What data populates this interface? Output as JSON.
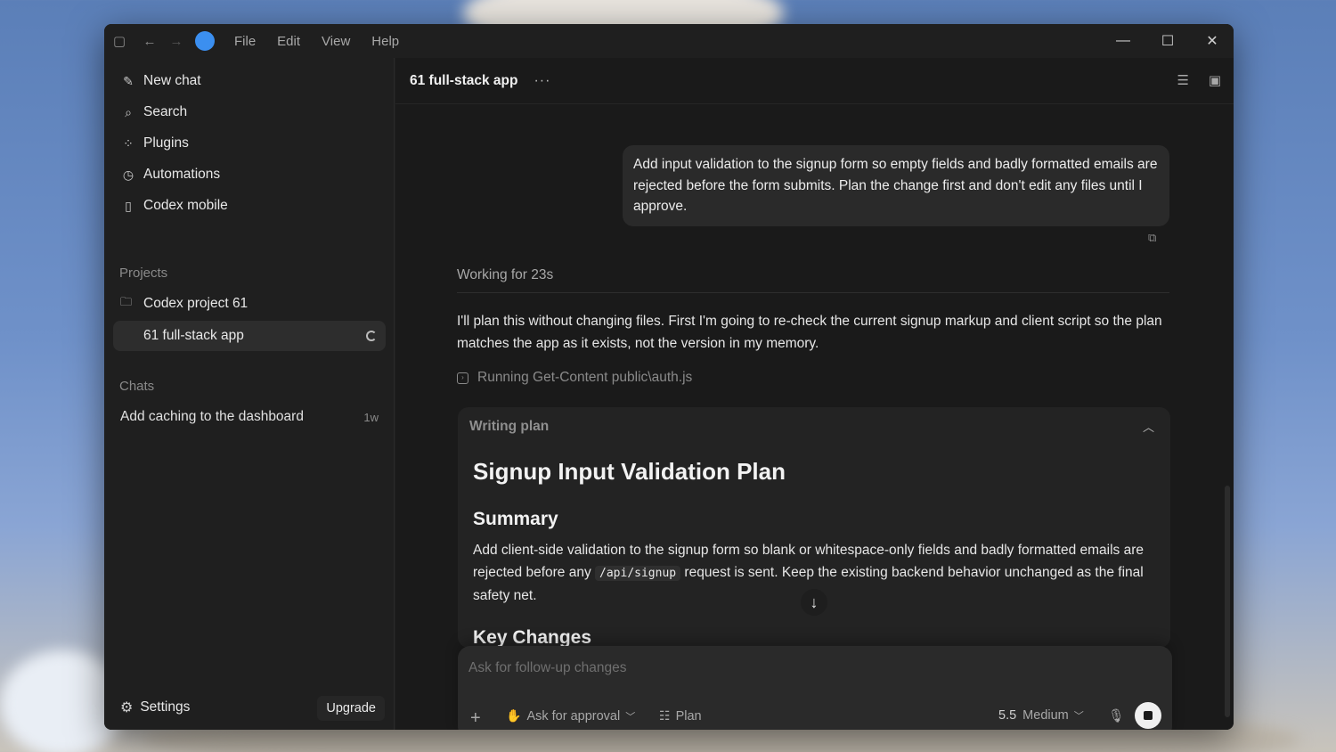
{
  "titlebar": {
    "menus": [
      "File",
      "Edit",
      "View",
      "Help"
    ],
    "window_controls": [
      "minimize",
      "maximize",
      "close"
    ]
  },
  "sidebar": {
    "nav": [
      {
        "label": "New chat",
        "icon": "edit-icon"
      },
      {
        "label": "Search",
        "icon": "search-icon"
      },
      {
        "label": "Plugins",
        "icon": "grid-icon"
      },
      {
        "label": "Automations",
        "icon": "clock-icon"
      },
      {
        "label": "Codex mobile",
        "icon": "phone-icon"
      }
    ],
    "projects_label": "Projects",
    "projects": [
      {
        "label": "Codex project 61",
        "icon": "folder-icon"
      },
      {
        "label": "61 full-stack app",
        "active": true
      }
    ],
    "chats_label": "Chats",
    "chats": [
      {
        "label": "Add caching to the dashboard",
        "age": "1w"
      }
    ],
    "settings_label": "Settings",
    "upgrade_label": "Upgrade"
  },
  "main": {
    "title": "61 full-stack app",
    "more": "···",
    "user_message": "Add input validation to the signup form so empty fields and badly formatted emails are rejected before the form submits. Plan the change first and don't edit any files until I approve.",
    "working": "Working for 23s",
    "assistant_text": "I'll plan this without changing files. First I'm going to re-check the current signup markup and client script so the plan matches the app as it exists, not the version in my memory.",
    "running": "Running Get-Content public\\auth.js",
    "plan": {
      "label": "Writing plan",
      "heading": "Signup Input Validation Plan",
      "summary_heading": "Summary",
      "summary_pre": "Add client-side validation to the signup form so blank or whitespace-only fields and badly formatted emails are rejected before any",
      "summary_code": "/api/signup",
      "summary_post": "request is sent. Keep the existing backend behavior unchanged as the final safety net.",
      "next_heading": "Key Changes"
    }
  },
  "composer": {
    "placeholder": "Ask for follow-up changes",
    "approval_label": "Ask for approval",
    "plan_label": "Plan",
    "model_label": "5.5",
    "effort_label": "Medium"
  },
  "colors": {
    "window_bg": "#1f1f1f",
    "main_bg": "#1a1a1a",
    "accent": "#3b8ff0"
  }
}
